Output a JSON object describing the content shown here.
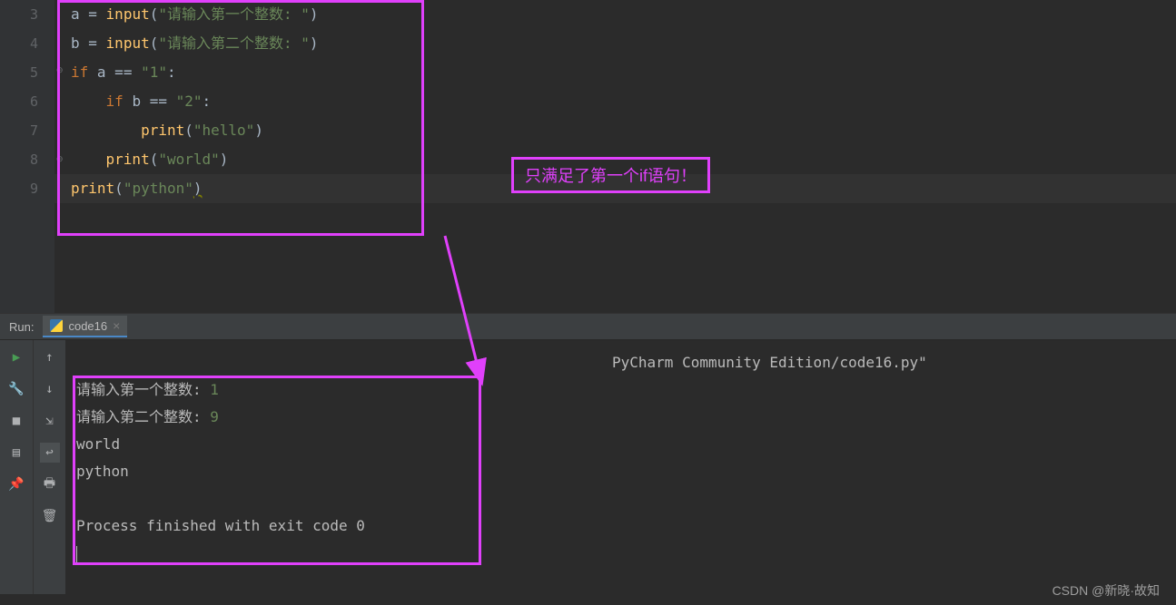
{
  "editor": {
    "line_numbers": [
      "3",
      "4",
      "5",
      "6",
      "7",
      "8",
      "9"
    ],
    "code": {
      "l3": {
        "var": "a",
        "eq": " = ",
        "fn": "input",
        "p1": "(",
        "str": "\"请输入第一个整数: \"",
        "p2": ")"
      },
      "l4": {
        "var": "b",
        "eq": " = ",
        "fn": "input",
        "p1": "(",
        "str": "\"请输入第二个整数: \"",
        "p2": ")"
      },
      "l5": {
        "kw": "if",
        "sp": " ",
        "var": "a",
        "op": " == ",
        "str": "\"1\"",
        "colon": ":"
      },
      "l6": {
        "indent": "    ",
        "kw": "if",
        "sp": " ",
        "var": "b",
        "op": " == ",
        "str": "\"2\"",
        "colon": ":"
      },
      "l7": {
        "indent": "        ",
        "fn": "print",
        "p1": "(",
        "str": "\"hello\"",
        "p2": ")"
      },
      "l8": {
        "indent": "    ",
        "fn": "print",
        "p1": "(",
        "str": "\"world\"",
        "p2": ")"
      },
      "l9": {
        "fn": "print",
        "p1": "(",
        "str": "\"python\"",
        "p2": ")"
      }
    }
  },
  "annotation": "只满足了第一个if语句！",
  "run_panel": {
    "label": "Run:",
    "tab_name": "code16"
  },
  "console": {
    "path": "PyCharm Community Edition/code16.py\"",
    "p1_label": "请输入第一个整数: ",
    "p1_val": "1",
    "p2_label": "请输入第二个整数: ",
    "p2_val": "9",
    "out1": "world",
    "out2": "python",
    "exit": "Process finished with exit code 0"
  },
  "watermark": "CSDN @新晓·故知"
}
